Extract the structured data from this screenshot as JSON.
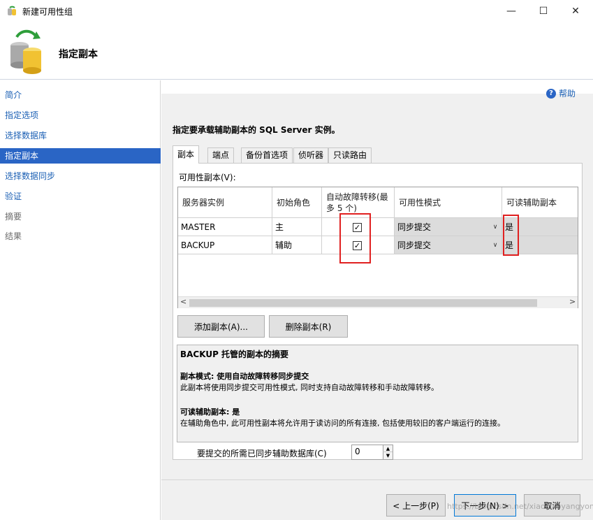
{
  "window": {
    "title": "新建可用性组",
    "minimize": "—",
    "maximize": "☐",
    "close": "✕"
  },
  "header": {
    "title": "指定副本"
  },
  "sidebar": {
    "items": [
      {
        "label": "简介",
        "state": "link"
      },
      {
        "label": "指定选项",
        "state": "link"
      },
      {
        "label": "选择数据库",
        "state": "link"
      },
      {
        "label": "指定副本",
        "state": "active"
      },
      {
        "label": "选择数据同步",
        "state": "link"
      },
      {
        "label": "验证",
        "state": "link"
      },
      {
        "label": "摘要",
        "state": "disabled"
      },
      {
        "label": "结果",
        "state": "disabled"
      }
    ]
  },
  "help": {
    "label": "帮助",
    "icon_glyph": "?"
  },
  "instruction": "指定要承载辅助副本的 SQL Server 实例。",
  "tabs": [
    {
      "label": "副本",
      "active": true
    },
    {
      "label": "端点",
      "active": false
    },
    {
      "label": "备份首选项",
      "active": false
    },
    {
      "label": "侦听器",
      "active": false
    },
    {
      "label": "只读路由",
      "active": false
    }
  ],
  "replicas_label": "可用性副本(V):",
  "grid": {
    "columns": {
      "server": "服务器实例",
      "role": "初始角色",
      "failover": "自动故障转移(最多 5 个)",
      "mode": "可用性模式",
      "readable": "可读辅助副本"
    },
    "rows": [
      {
        "server": "MASTER",
        "role": "主",
        "failover": true,
        "check_glyph": "✓",
        "mode": "同步提交",
        "readable": "是"
      },
      {
        "server": "BACKUP",
        "role": "辅助",
        "failover": true,
        "check_glyph": "✓",
        "mode": "同步提交",
        "readable": "是"
      }
    ],
    "scroll_left": "<",
    "scroll_right": ">",
    "dropdown_glyph": "∨"
  },
  "buttons": {
    "add_replica": "添加副本(A)...",
    "remove_replica": "删除副本(R)",
    "back": "< 上一步(P)",
    "next": "下一步(N) >",
    "cancel": "取消"
  },
  "summary": {
    "heading": "BACKUP 托管的副本的摘要",
    "mode_title": "副本模式: 使用自动故障转移同步提交",
    "mode_desc": "此副本将使用同步提交可用性模式, 同时支持自动故障转移和手动故障转移。",
    "readable_title": "可读辅助副本: 是",
    "readable_desc": "在辅助角色中, 此可用性副本将允许用于读访问的所有连接, 包括使用较旧的客户端运行的连接。"
  },
  "sync": {
    "label": "要提交的所需已同步辅助数据库(C)",
    "value": "0"
  },
  "watermark": "https://blog.csdn.net/xiaoxiaoyangyong"
}
